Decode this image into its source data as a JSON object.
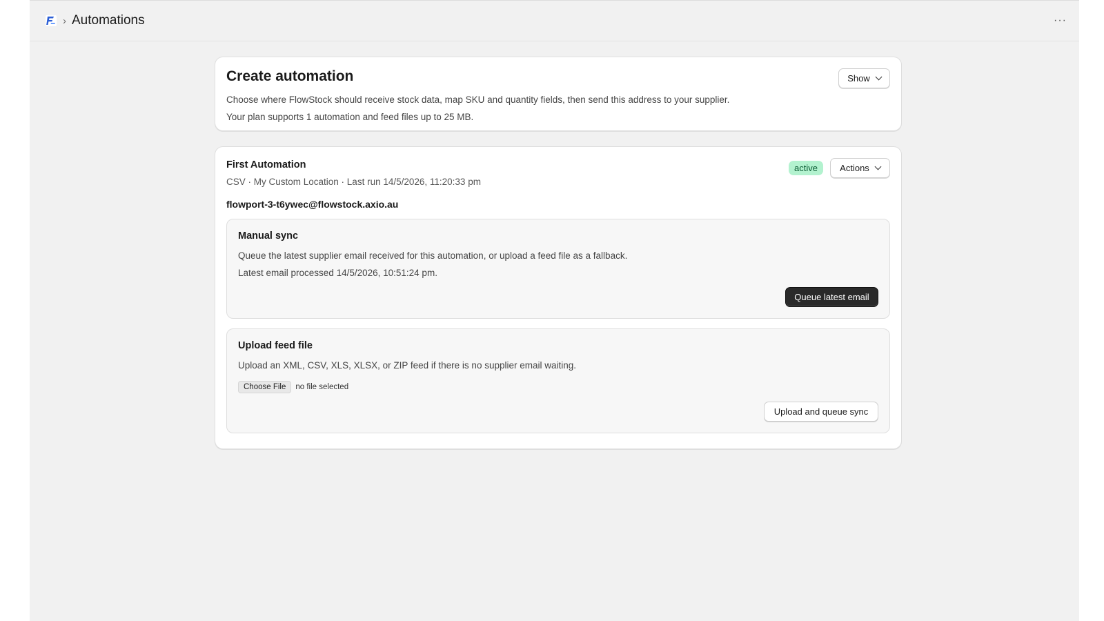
{
  "header": {
    "logo_icon": "flowstock-logo-icon",
    "separator": "›",
    "title": "Automations",
    "more_label": "···"
  },
  "create_card": {
    "title": "Create automation",
    "description": "Choose where FlowStock should receive stock data, map SKU and quantity fields, then send this address to your supplier.",
    "plan_note": "Your plan supports 1 automation and feed files up to 25 MB.",
    "show_label": "Show"
  },
  "automation": {
    "name": "First Automation",
    "meta": "CSV · My Custom Location · Last run 14/5/2026, 11:20:33 pm",
    "email": "flowport-3-t6ywec@flowstock.axio.au",
    "status": "active",
    "actions_label": "Actions",
    "manual_sync": {
      "title": "Manual sync",
      "description": "Queue the latest supplier email received for this automation, or upload a feed file as a fallback.",
      "latest": "Latest email processed 14/5/2026, 10:51:24 pm.",
      "button": "Queue latest email"
    },
    "upload": {
      "title": "Upload feed file",
      "description": "Upload an XML, CSV, XLS, XLSX, or ZIP feed if there is no supplier email waiting.",
      "choose_label": "Choose File",
      "file_status": "no file selected",
      "button": "Upload and queue sync"
    }
  },
  "colors": {
    "badge_bg": "#b3f2cf",
    "badge_text": "#0a5c33",
    "primary_button": "#2a2a2a"
  }
}
